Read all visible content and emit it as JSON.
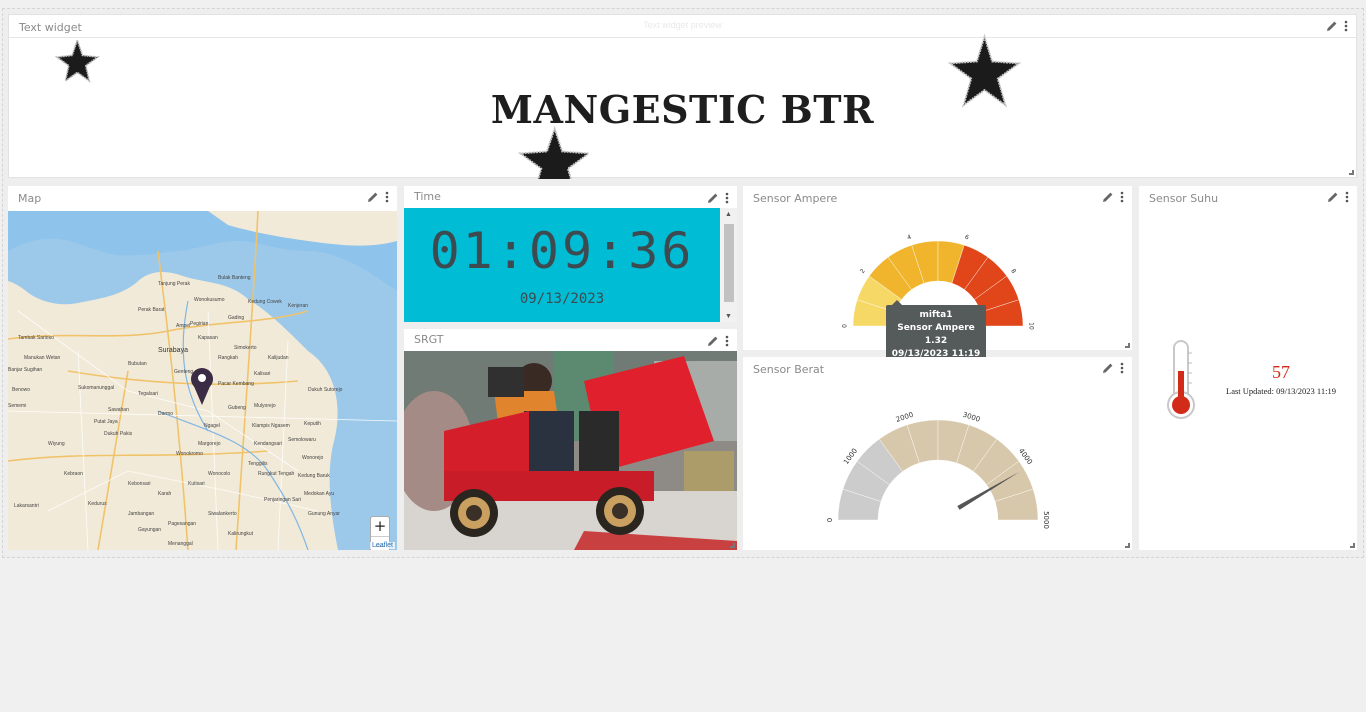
{
  "text_widget": {
    "title": "Text widget",
    "banner": "MANGESTIC BTR",
    "ghost_hint": "Text widget preview"
  },
  "map": {
    "title": "Map",
    "zoom_in": "+",
    "zoom_out": "−",
    "attribution": "Leaflet",
    "labels": {
      "city": "Surabaya",
      "l1": "Bulak Banteng",
      "l2": "Wonokusumo",
      "l3": "Kedung Cowek",
      "l4": "Pegirian",
      "l5": "Gading",
      "l6": "Kenjeran",
      "l7": "Kapasan",
      "l8": "Simokerto",
      "l9": "Rangkah",
      "l10": "Genteng",
      "l11": "Pacar Kembang",
      "l12": "Gubeng",
      "l13": "Mulyorejo",
      "l14": "Kalisari",
      "l15": "Tambak Sarioso",
      "l16": "Manukan Wetan",
      "l17": "Banjar Sugihan",
      "l18": "Sukomanunggal",
      "l19": "Darmo",
      "l20": "Wonokromo",
      "l21": "Kendangsari",
      "l22": "Rungkut Tengah",
      "l23": "Gunung Anyar",
      "l24": "Medokan Ayu",
      "l25": "Keputih",
      "l26": "Kedurus",
      "l27": "Jambangan",
      "l28": "Karah",
      "l29": "Dukuh Pakis",
      "l30": "Kebraon",
      "l31": "Wiyung",
      "l32": "Wonocolo",
      "l33": "Siwalankerto",
      "l34": "Gayungan",
      "l35": "Wonorejo",
      "l36": "Penjaringan Sari",
      "l37": "Kalirungkut",
      "l38": "Perak Barat",
      "l39": "Tanjung Perak",
      "l40": "Ampel",
      "l41": "Bubutan",
      "l42": "Tegalsari",
      "l43": "Sawahan",
      "l44": "Putat Jaya",
      "l45": "Kalijudan",
      "l46": "Dukuh Sutorejo",
      "l47": "Klampis Ngasem",
      "l48": "Semolowaru",
      "l49": "Tenggilis",
      "l50": "Kutisari",
      "l51": "Margorejo",
      "l52": "Ngagel",
      "l53": "Kebonsari",
      "l54": "Menanggal",
      "l55": "Kedung Baruk",
      "l56": "Pagesangan",
      "l57": "Lakarsantri",
      "l58": "Sememi",
      "l59": "Benowo"
    }
  },
  "time": {
    "title": "Time",
    "clock": "01:09:36",
    "date": "09/13/2023"
  },
  "srgt": {
    "title": "SRGT"
  },
  "sensor_ampere": {
    "title": "Sensor Ampere",
    "min": 0,
    "max": 10,
    "value": 1.32,
    "ticks": [
      "0",
      "2",
      "4",
      "6",
      "8",
      "10"
    ],
    "tooltip": {
      "name": "mifta1",
      "line": "Sensor Ampere 1.32",
      "time": "09/13/2023 11:19"
    }
  },
  "sensor_berat": {
    "title": "Sensor Berat",
    "min": 0,
    "max": 5000,
    "value": 4150,
    "ticks": [
      "0",
      "1000",
      "2000",
      "3000",
      "4000",
      "5000"
    ]
  },
  "sensor_suhu": {
    "title": "Sensor Suhu",
    "value": "57",
    "last_updated": "Last Updated: 09/13/2023 11:19",
    "level_fraction": 0.57
  },
  "colors": {
    "clock_bg": "#00bcd4",
    "amp_yellow": "#f6d867",
    "amp_orange": "#f0b52c",
    "amp_red": "#e0461a",
    "berat_grey": "#cccccc",
    "berat_tan": "#d8c8ab",
    "suhu_red": "#d32b1a"
  }
}
